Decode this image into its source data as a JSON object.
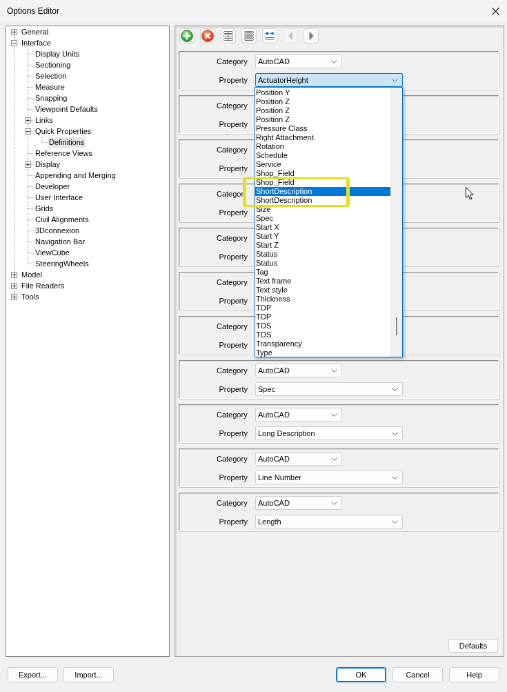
{
  "window": {
    "title": "Options Editor"
  },
  "tree": [
    {
      "label": "General",
      "expanded": false,
      "selected": false
    },
    {
      "label": "Interface",
      "expanded": true,
      "selected": false,
      "children": [
        {
          "label": "Display Units",
          "selected": false
        },
        {
          "label": "Sectioning",
          "selected": false
        },
        {
          "label": "Selection",
          "selected": false
        },
        {
          "label": "Measure",
          "selected": false
        },
        {
          "label": "Snapping",
          "selected": false
        },
        {
          "label": "Viewpoint Defaults",
          "selected": false
        },
        {
          "label": "Links",
          "expanded": false,
          "selected": false
        },
        {
          "label": "Quick Properties",
          "expanded": true,
          "selected": false,
          "children": [
            {
              "label": "Definitions",
              "selected": true
            }
          ]
        },
        {
          "label": "Reference Views",
          "selected": false
        },
        {
          "label": "Display",
          "expanded": false,
          "selected": false
        },
        {
          "label": "Appending and Merging",
          "selected": false
        },
        {
          "label": "Developer",
          "selected": false
        },
        {
          "label": "User Interface",
          "selected": false
        },
        {
          "label": "Grids",
          "selected": false
        },
        {
          "label": "Civil Alignments",
          "selected": false
        },
        {
          "label": "3Dconnexion",
          "selected": false
        },
        {
          "label": "Navigation Bar",
          "selected": false
        },
        {
          "label": "ViewCube",
          "selected": false
        },
        {
          "label": "SteeringWheels",
          "selected": false
        }
      ]
    },
    {
      "label": "Model",
      "expanded": false,
      "selected": false
    },
    {
      "label": "File Readers",
      "expanded": false,
      "selected": false
    },
    {
      "label": "Tools",
      "expanded": false,
      "selected": false
    }
  ],
  "toolbar": [
    {
      "kind": "add",
      "disabled": false
    },
    {
      "kind": "remove",
      "disabled": false
    },
    {
      "kind": "rows",
      "disabled": false
    },
    {
      "kind": "lines",
      "disabled": false
    },
    {
      "kind": "swap",
      "disabled": false
    },
    {
      "kind": "previous",
      "disabled": true
    },
    {
      "kind": "next",
      "disabled": false
    }
  ],
  "definitions": [
    {
      "category_label": "Category",
      "category": "AutoCAD",
      "property_label": "Property",
      "property": "ActuatorHeight",
      "open": true,
      "dropdown_items": [
        {
          "label": "Position Y",
          "selected": false,
          "highlighted": false
        },
        {
          "label": "Position Z",
          "selected": false,
          "highlighted": false
        },
        {
          "label": "Position Z",
          "selected": false,
          "highlighted": false
        },
        {
          "label": "Position Z",
          "selected": false,
          "highlighted": false
        },
        {
          "label": "Pressure Class",
          "selected": false,
          "highlighted": false
        },
        {
          "label": "Right Attachment",
          "selected": false,
          "highlighted": false
        },
        {
          "label": "Rotation",
          "selected": false,
          "highlighted": false
        },
        {
          "label": "Schedule",
          "selected": false,
          "highlighted": false
        },
        {
          "label": "Service",
          "selected": false,
          "highlighted": false
        },
        {
          "label": "Shop_Field",
          "selected": false,
          "highlighted": false
        },
        {
          "label": "Shop_Field",
          "selected": false,
          "highlighted": true
        },
        {
          "label": "ShortDescription",
          "selected": true,
          "highlighted": true
        },
        {
          "label": "ShortDescription",
          "selected": false,
          "highlighted": true
        },
        {
          "label": "Size",
          "selected": false,
          "highlighted": false
        },
        {
          "label": "Spec",
          "selected": false,
          "highlighted": false
        },
        {
          "label": "Start X",
          "selected": false,
          "highlighted": false
        },
        {
          "label": "Start Y",
          "selected": false,
          "highlighted": false
        },
        {
          "label": "Start Z",
          "selected": false,
          "highlighted": false
        },
        {
          "label": "Status",
          "selected": false,
          "highlighted": false
        },
        {
          "label": "Status",
          "selected": false,
          "highlighted": false
        },
        {
          "label": "Tag",
          "selected": false,
          "highlighted": false
        },
        {
          "label": "Text frame",
          "selected": false,
          "highlighted": false
        },
        {
          "label": "Text style",
          "selected": false,
          "highlighted": false
        },
        {
          "label": "Thickness",
          "selected": false,
          "highlighted": false
        },
        {
          "label": "TOP",
          "selected": false,
          "highlighted": false
        },
        {
          "label": "TOP",
          "selected": false,
          "highlighted": false
        },
        {
          "label": "TOS",
          "selected": false,
          "highlighted": false
        },
        {
          "label": "TOS",
          "selected": false,
          "highlighted": false
        },
        {
          "label": "Transparency",
          "selected": false,
          "highlighted": false
        },
        {
          "label": "Type",
          "selected": false,
          "highlighted": false
        }
      ]
    },
    {
      "category_label": "Category",
      "property_label": "Property"
    },
    {
      "category_label": "Category",
      "property_label": "Property"
    },
    {
      "category_label": "Categor",
      "property_label": "Property"
    },
    {
      "category_label": "Category",
      "property_label": "Property"
    },
    {
      "category_label": "Category",
      "property_label": "Property"
    },
    {
      "category_label": "Category",
      "property_label": "Property"
    },
    {
      "category_label": "Category",
      "category": "AutoCAD",
      "property_label": "Property",
      "property": "Spec",
      "open": false
    },
    {
      "category_label": "Category",
      "category": "AutoCAD",
      "property_label": "Property",
      "property": "Long Description",
      "open": false
    },
    {
      "category_label": "Category",
      "category": "AutoCAD",
      "property_label": "Property",
      "property": "Line Number",
      "open": false
    },
    {
      "category_label": "Category",
      "category": "AutoCAD",
      "property_label": "Property",
      "property": "Length",
      "open": false
    }
  ],
  "defaults_button": "Defaults",
  "footer": {
    "left_buttons": [
      "Export...",
      "Import..."
    ],
    "right_buttons": [
      {
        "label": "OK",
        "default": true
      },
      {
        "label": "Cancel",
        "default": false
      },
      {
        "label": "Help",
        "default": false
      }
    ]
  }
}
